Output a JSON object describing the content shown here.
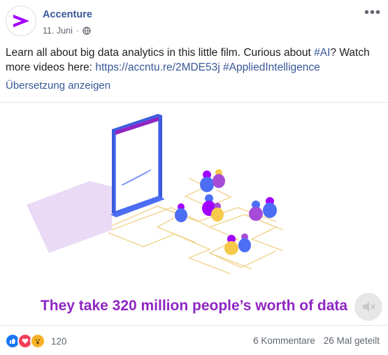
{
  "post": {
    "author": "Accenture",
    "date": "11. Juni",
    "privacy_icon": "globe-icon",
    "text": "Learn all about big data analytics in this little film. Curious about ",
    "hashtag_ai": "#AI",
    "text_mid": "? Watch more videos here: ",
    "link": "https://accntu.re/2MDE53j",
    "hashtag_applied": "#AppliedIntelligence",
    "translate_label": "Übersetzung anzeigen",
    "more_label": "•••"
  },
  "video": {
    "caption": "They take 320 million people’s worth of data",
    "mute_icon": "volume-muted-icon"
  },
  "footer": {
    "reactions": [
      "like",
      "love",
      "wow"
    ],
    "reaction_count": "120",
    "comments": "6 Kommentare",
    "shares": "26 Mal geteilt"
  },
  "colors": {
    "link": "#385898",
    "caption": "#8e26c2",
    "brand": "#a100ff"
  }
}
